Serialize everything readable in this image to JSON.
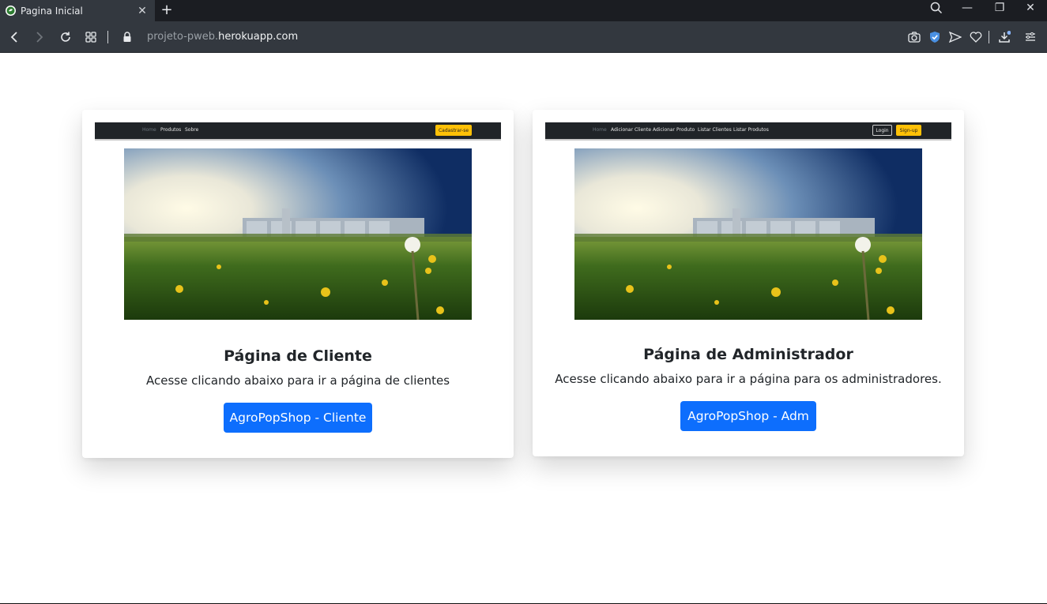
{
  "browser": {
    "tab_title": "Pagina Inicial",
    "tab_close": "✕",
    "new_tab": "+",
    "url_prefix": "projeto-pweb.",
    "url_domain": "herokuapp.com",
    "window_buttons": {
      "minimize": "—",
      "restore": "❐",
      "close": "✕"
    }
  },
  "cards": {
    "cliente": {
      "preview_nav": {
        "links": [
          "Home",
          "Produtos",
          "Sobre"
        ],
        "button": "Cadastrar-se"
      },
      "title": "Página de Cliente",
      "text": "Acesse clicando abaixo para ir a página de clientes",
      "button": "AgroPopShop - Cliente"
    },
    "adm": {
      "preview_nav": {
        "links": [
          "Home",
          "Adicionar Cliente",
          "Adicionar Produto",
          "Listar Clientes",
          "Listar Produtos"
        ],
        "login": "Login",
        "signup": "Sign-up"
      },
      "title": "Página de Administrador",
      "text": "Acesse clicando abaixo para ir a página para os administradores.",
      "button": "AgroPopShop - Adm"
    }
  },
  "colors": {
    "primary": "#0d6efd",
    "warning": "#ffc107",
    "navbar_dark": "#202428",
    "chrome_bg": "#33383f"
  },
  "icons": [
    "favicon-icon",
    "back-icon",
    "forward-icon",
    "reload-icon",
    "tabs-grid-icon",
    "lock-icon",
    "search-icon",
    "camera-icon",
    "shield-icon",
    "send-icon",
    "heart-icon",
    "download-icon",
    "menu-icon"
  ]
}
